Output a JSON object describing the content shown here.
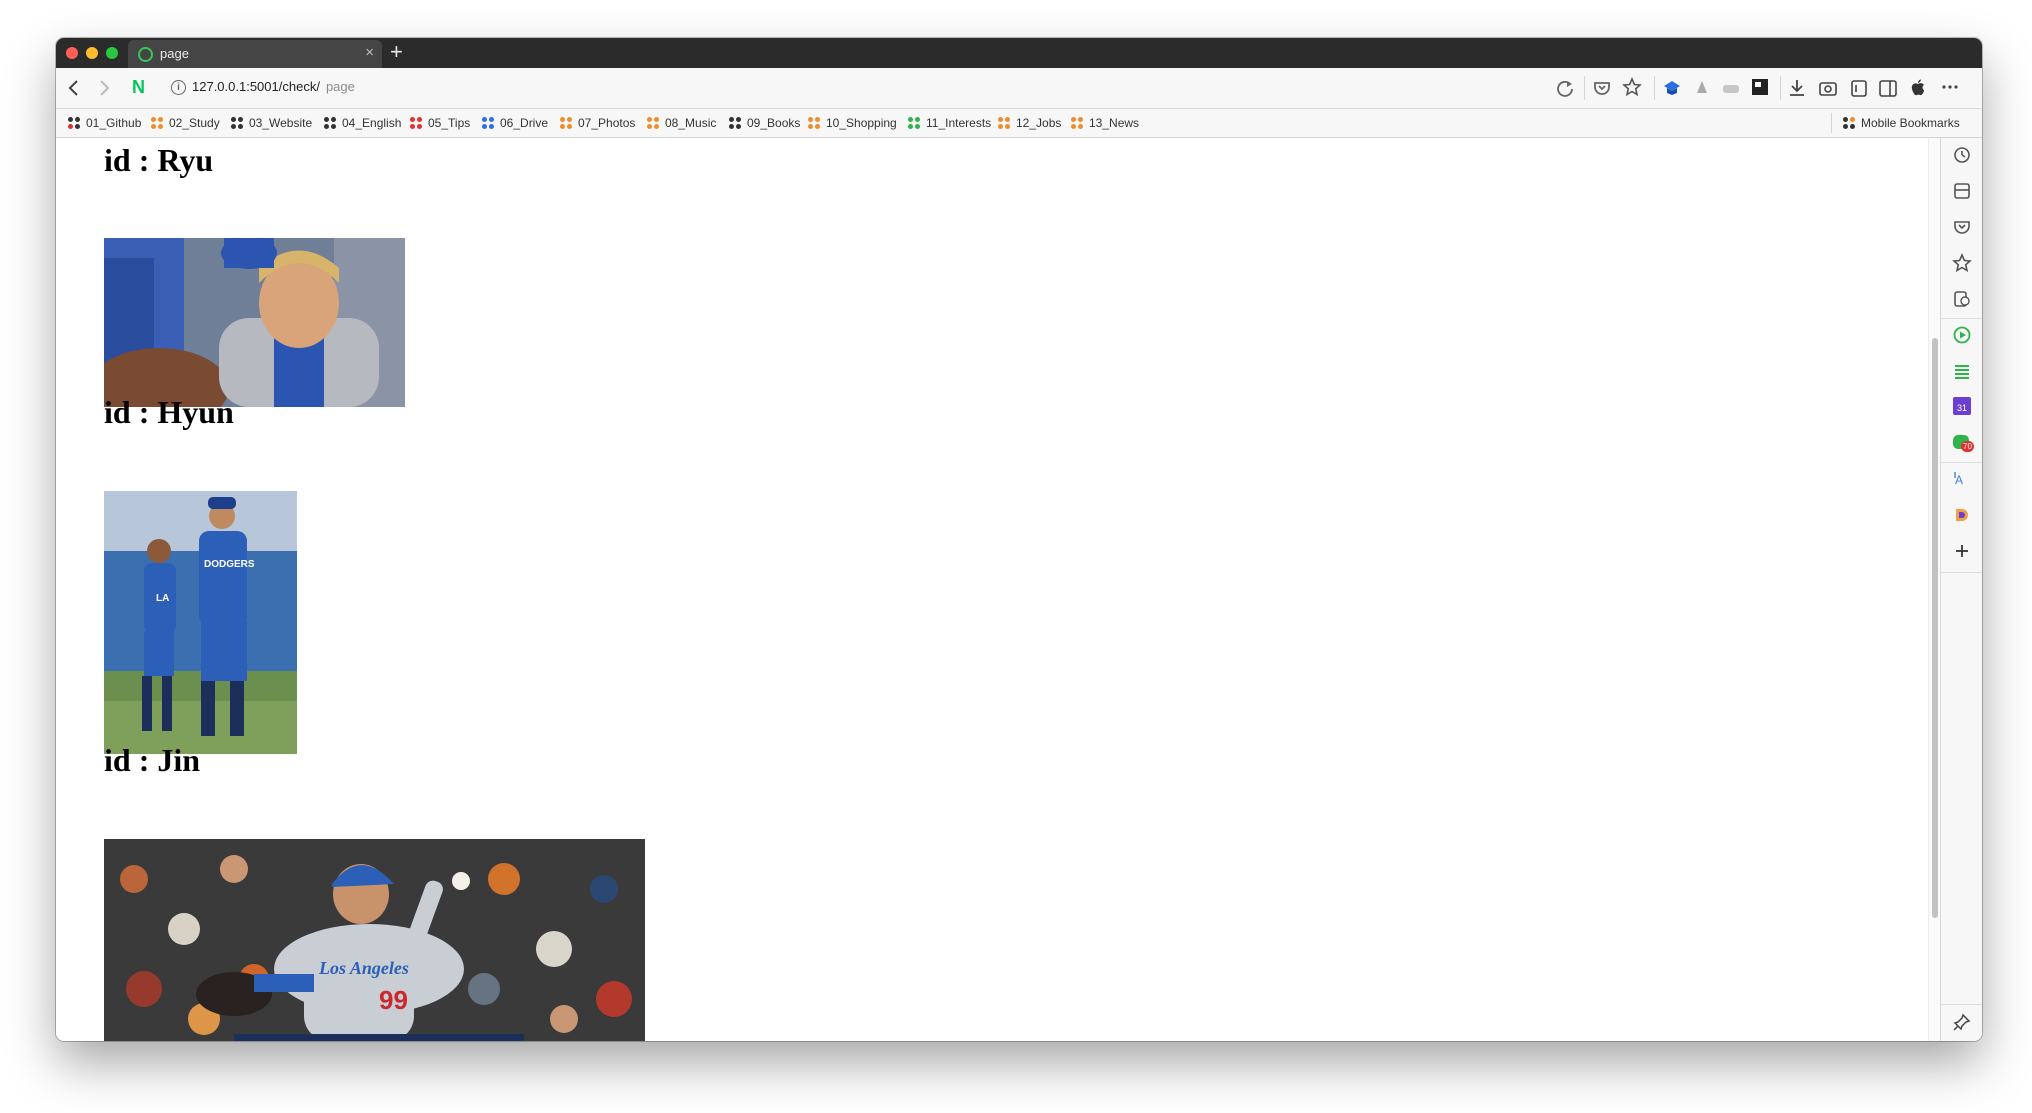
{
  "browser": {
    "tab_title": "page",
    "tab_close": "×",
    "new_tab": "+",
    "url_host": "127.0.0.1:5001/check/",
    "url_page": "page",
    "brand_logo": "N"
  },
  "bookmarks": {
    "items": [
      {
        "label": "01_Github",
        "color": "#333333"
      },
      {
        "label": "02_Study",
        "color": "#f08c2c"
      },
      {
        "label": "03_Website",
        "color": "#333333"
      },
      {
        "label": "04_English",
        "color": "#333333"
      },
      {
        "label": "05_Tips",
        "color": "#e0322f"
      },
      {
        "label": "06_Drive",
        "color": "#2f6fe0"
      },
      {
        "label": "07_Photos",
        "color": "#f08c2c"
      },
      {
        "label": "08_Music",
        "color": "#f08c2c"
      },
      {
        "label": "09_Books",
        "color": "#333333"
      },
      {
        "label": "10_Shopping",
        "color": "#f08c2c"
      },
      {
        "label": "11_Interests",
        "color": "#2fb34a"
      },
      {
        "label": "12_Jobs",
        "color": "#f08c2c"
      },
      {
        "label": "13_News",
        "color": "#f08c2c"
      }
    ],
    "mobile": "Mobile Bookmarks"
  },
  "entries": [
    {
      "title": "id : Ryu",
      "image": "ryu-photo"
    },
    {
      "title": "id : Hyun",
      "image": "hyun-photo"
    },
    {
      "title": "id : Jin",
      "image": "jin-photo"
    }
  ],
  "photo_text": {
    "jersey_dodgers": "DODGERS",
    "jersey_la": "LA",
    "jersey_los_angeles": "Los Angeles",
    "jersey_number": "99"
  },
  "sidebar": {
    "badge_count": "70",
    "calendar_day": "31"
  },
  "colors": {
    "accent_green": "#03c75a",
    "dodger_blue": "#2c5fb8"
  }
}
